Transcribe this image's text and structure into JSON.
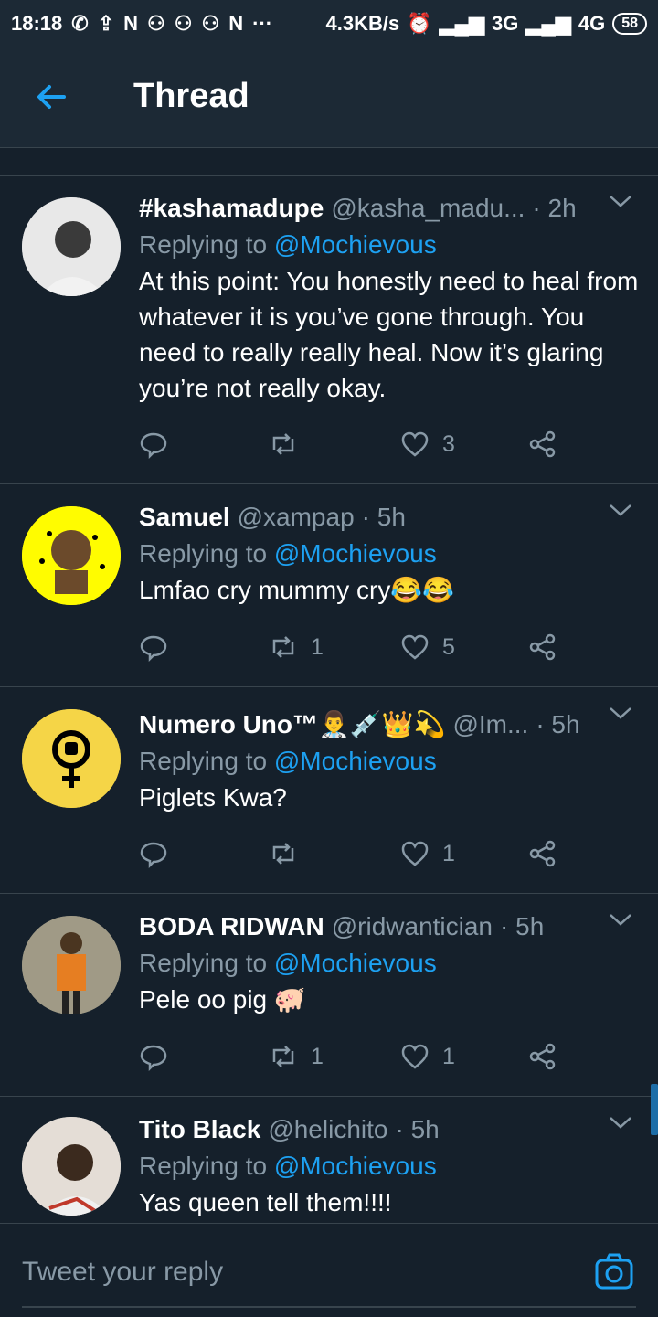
{
  "status": {
    "time": "18:18",
    "netspeed": "4.3KB/s",
    "net1": "3G",
    "net2": "4G",
    "battery": "58"
  },
  "header": {
    "title": "Thread"
  },
  "tweets": [
    {
      "name": "#kashamadupe",
      "handle": "@kasha_madu...",
      "time": "· 2h",
      "replying_prefix": "Replying to ",
      "mention": "@Mochievous",
      "text": "At this point: You honestly need to heal from whatever it is you’ve gone through. You need to really really heal. Now it’s glaring you’re not really okay.",
      "retweets": "",
      "likes": "3"
    },
    {
      "name": "Samuel",
      "handle": "@xampap",
      "time": "· 5h",
      "replying_prefix": "Replying to ",
      "mention": "@Mochievous",
      "text": "Lmfao cry mummy cry😂😂",
      "retweets": "1",
      "likes": "5"
    },
    {
      "name": "Numero Uno™👨‍⚕️💉👑💫",
      "handle": "@Im...",
      "time": "· 5h",
      "replying_prefix": "Replying to ",
      "mention": "@Mochievous",
      "text": "Piglets Kwa?",
      "retweets": "",
      "likes": "1"
    },
    {
      "name": "BODA RIDWAN",
      "handle": "@ridwantician",
      "time": "· 5h",
      "replying_prefix": "Replying to ",
      "mention": "@Mochievous",
      "text": "Pele oo pig 🐖",
      "retweets": "1",
      "likes": "1"
    },
    {
      "name": "Tito Black",
      "handle": "@helichito",
      "time": "· 5h",
      "replying_prefix": "Replying to ",
      "mention": "@Mochievous",
      "text": "Yas queen tell them!!!!",
      "retweets": "",
      "likes": ""
    }
  ],
  "compose": {
    "placeholder": "Tweet your reply"
  },
  "colors": {
    "background": "#15202b",
    "accent": "#1da1f2",
    "muted": "#8899a6",
    "divider": "#38444d"
  }
}
